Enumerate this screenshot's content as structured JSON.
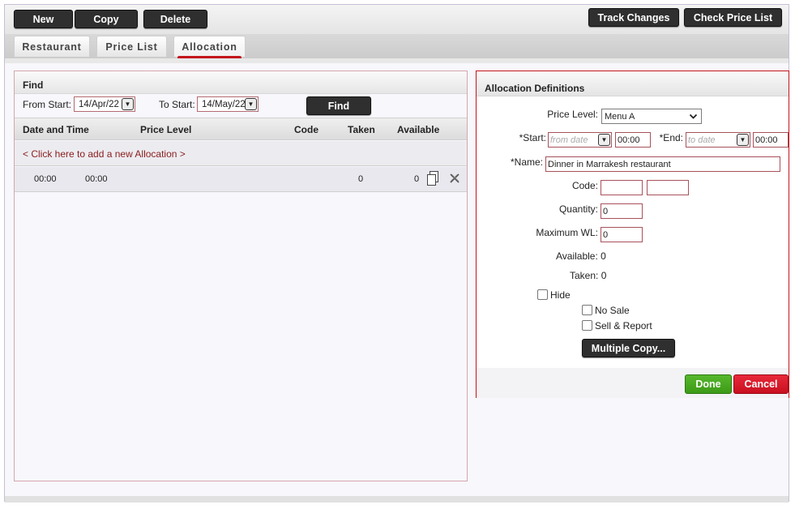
{
  "toolbar": {
    "new_label": "New",
    "copy_label": "Copy",
    "delete_label": "Delete",
    "track_changes_label": "Track Changes",
    "check_price_list_label": "Check Price List"
  },
  "tabs": [
    {
      "label": "Restaurant"
    },
    {
      "label": "Price List"
    },
    {
      "label": "Allocation",
      "active": true
    }
  ],
  "find": {
    "title": "Find",
    "from_start_label": "From Start:",
    "from_start_value": "14/Apr/22",
    "to_start_label": "To Start:",
    "to_start_value": "14/May/22",
    "find_button": "Find"
  },
  "table": {
    "columns": [
      "Date and Time",
      "Price Level",
      "Code",
      "Taken",
      "Available"
    ],
    "add_link": "< Click here to add a new Allocation >",
    "rows": [
      {
        "start_time": "00:00",
        "end_time": "00:00",
        "taken": "0",
        "available": "0"
      }
    ]
  },
  "allocation": {
    "title": "Allocation Definitions",
    "price_level_label": "Price Level:",
    "price_level_value": "Menu A",
    "start_label": "*Start:",
    "start_date_placeholder": "from date",
    "start_time": "00:00",
    "end_label": "*End:",
    "end_date_placeholder": "to date",
    "end_time": "00:00",
    "name_label": "*Name:",
    "name_value": "Dinner in Marrakesh restaurant",
    "code_label": "Code:",
    "quantity_label": "Quantity:",
    "quantity_value": "0",
    "max_wl_label": "Maximum WL:",
    "max_wl_value": "0",
    "available_text": "Available: 0",
    "taken_text": "Taken: 0",
    "hide_label": "Hide",
    "no_sale_label": "No Sale",
    "sell_report_label": "Sell & Report",
    "multiple_copy_label": "Multiple Copy...",
    "done_label": "Done",
    "cancel_label": "Cancel"
  },
  "colors": {
    "accent_red": "#c4161c",
    "done_green": "#3d9a17",
    "dark_button": "#2f2f2f",
    "link_color": "#8a1c1c"
  }
}
